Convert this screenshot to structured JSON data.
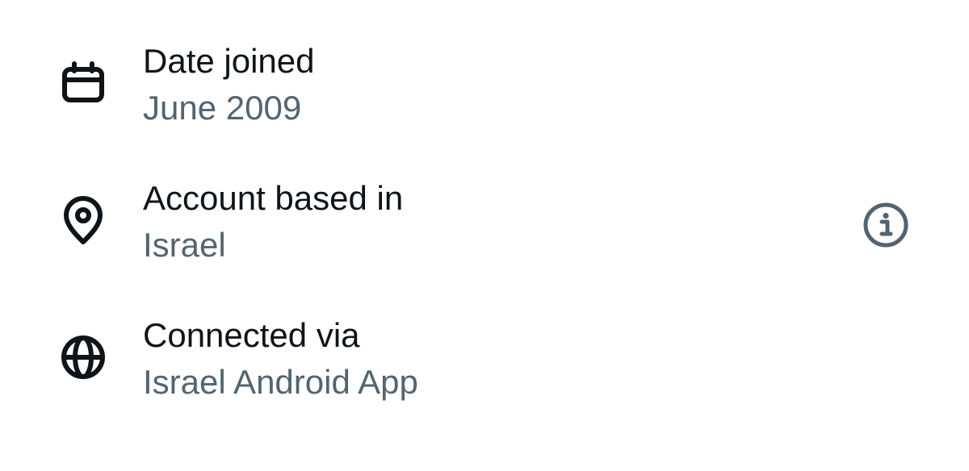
{
  "account_info": {
    "date_joined": {
      "label": "Date joined",
      "value": "June 2009",
      "icon": "calendar-icon"
    },
    "account_based_in": {
      "label": "Account based in",
      "value": "Israel",
      "icon": "location-pin-icon",
      "info_icon": "info-icon"
    },
    "connected_via": {
      "label": "Connected via",
      "value": "Israel Android App",
      "icon": "globe-icon"
    }
  },
  "colors": {
    "primary_text": "#0f1419",
    "secondary_text": "#536471",
    "background": "#ffffff"
  }
}
